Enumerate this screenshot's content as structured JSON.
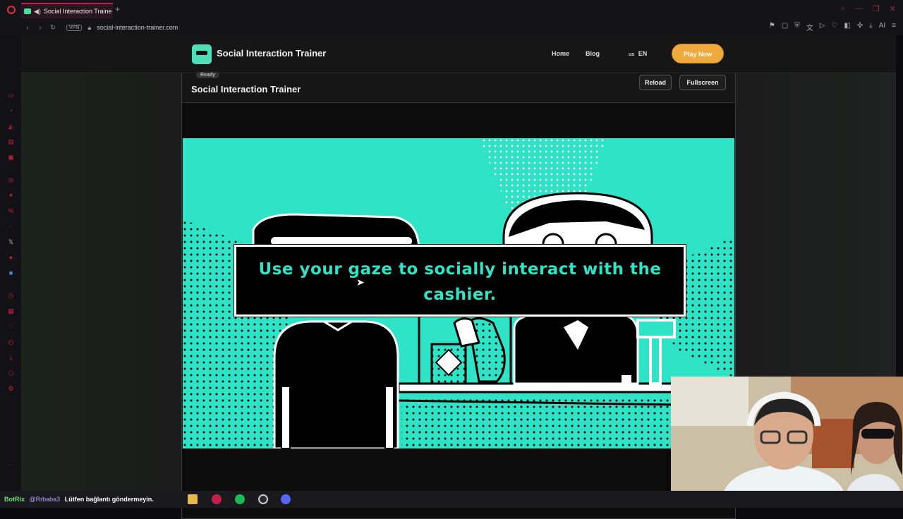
{
  "browser": {
    "tab_title": "Social Interaction Traine",
    "url": "social-interaction-trainer.com",
    "vpn_label": "VPN",
    "toolbar_right_label": "AI"
  },
  "site": {
    "title": "Social Interaction Trainer",
    "nav": {
      "home": "Home",
      "blog": "Blog"
    },
    "language": {
      "flag": "us",
      "code": "EN"
    },
    "cta": "Play Now"
  },
  "game": {
    "status": "Ready",
    "title": "Social Interaction Trainer",
    "reload": "Reload",
    "fullscreen": "Fullscreen",
    "dialog": "Use your gaze to socially interact with the cashier."
  },
  "chat": {
    "bot": "BotRix",
    "mention": "@Rrbaba3",
    "message": "Lütfen bağlantı göndermeyin."
  },
  "colors": {
    "accent_teal": "#2fe3c7",
    "cta_orange": "#f0a93c",
    "opera_red": "#c31f4b"
  }
}
